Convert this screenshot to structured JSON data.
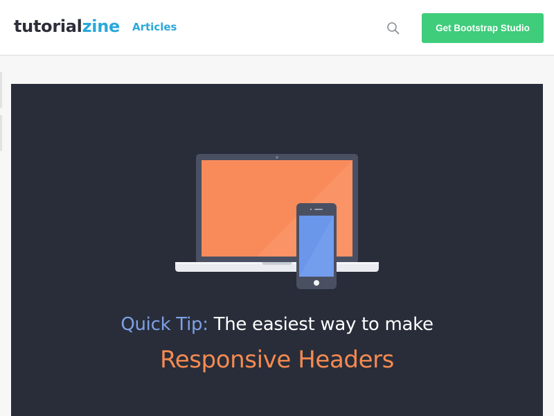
{
  "header": {
    "logo": {
      "part1": "tutorial",
      "part2": "zine"
    },
    "nav": {
      "articles_label": "Articles"
    },
    "search_icon": "search-icon",
    "cta_label": "Get Bootstrap Studio"
  },
  "hero": {
    "tag": "Quick Tip:",
    "subtitle": "The easiest way to make",
    "title": "Responsive Headers",
    "illustration": [
      "laptop-icon",
      "smartphone-icon"
    ]
  },
  "colors": {
    "brand_accent": "#2aa8d9",
    "cta": "#3fcc7b",
    "hero_bg": "#282d39",
    "hero_tag": "#7ea1e6",
    "hero_title": "#f58a52",
    "laptop_screen": "#f98b5b",
    "phone_screen": "#6b97ea"
  }
}
